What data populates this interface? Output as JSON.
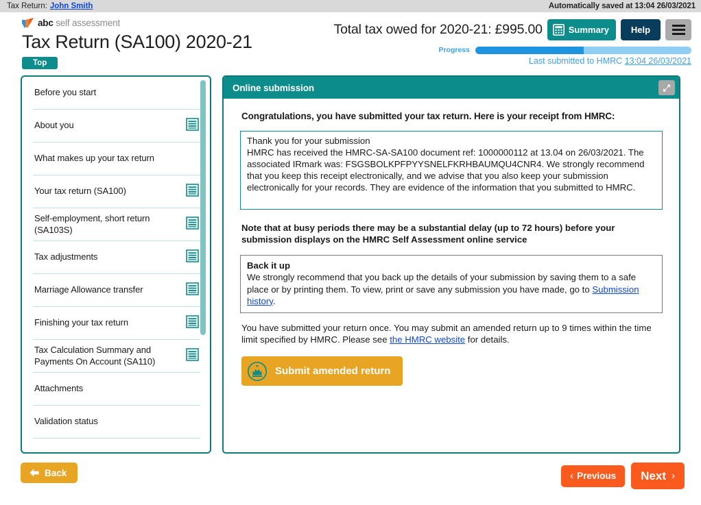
{
  "topbar": {
    "label": "Tax Return:",
    "user_name": "John Smith",
    "autosave": "Automatically saved at 13:04 26/03/2021"
  },
  "header": {
    "brand_abc": "abc",
    "brand_suffix": " self assessment",
    "page_title": "Tax Return (SA100) 2020-21",
    "top_badge": "Top",
    "total_owed": "Total tax owed for 2020-21: £995.00",
    "summary_label": "Summary",
    "help_label": "Help",
    "progress_label": "Progress",
    "progress_percent": 50,
    "last_submitted_label": "Last submitted to HMRC",
    "last_submitted_value": "13:04 26/03/2021"
  },
  "sidebar": {
    "items": [
      {
        "label": "Before you start",
        "has_doc_icon": false
      },
      {
        "label": "About you",
        "has_doc_icon": true
      },
      {
        "label": "What makes up your tax return",
        "has_doc_icon": false
      },
      {
        "label": "Your tax return (SA100)",
        "has_doc_icon": true
      },
      {
        "label": "Self-employment, short return (SA103S)",
        "has_doc_icon": true
      },
      {
        "label": "Tax adjustments",
        "has_doc_icon": true
      },
      {
        "label": "Marriage Allowance transfer",
        "has_doc_icon": true
      },
      {
        "label": "Finishing your tax return",
        "has_doc_icon": true
      },
      {
        "label": "Tax Calculation Summary and Payments On Account (SA110)",
        "has_doc_icon": true
      },
      {
        "label": "Attachments",
        "has_doc_icon": false
      },
      {
        "label": "Validation status",
        "has_doc_icon": false
      }
    ]
  },
  "panel": {
    "title": "Online submission",
    "congrats": "Congratulations, you have submitted your tax return. Here is your receipt from HMRC:",
    "receipt": {
      "line1": "Thank you for your submission",
      "line2": "HMRC has received the HMRC-SA-SA100 document ref: 1000000112 at 13.04 on 26/03/2021. The associated IRmark was: FSGSBOLKPFPYYSNELFKRHBAUMQU4CNR4. We strongly recommend that you keep this receipt electronically, and we advise that you also keep your submission electronically for your records. They are evidence of the information that you submitted to HMRC."
    },
    "note": "Note that at busy periods there may be a substantial delay (up to 72 hours) before your submission displays on the HMRC Self Assessment online service",
    "backup": {
      "title": "Back it up",
      "text_before": "We strongly recommend that you back up the details of your submission by saving them to a safe place or by printing them. To view, print or save any submission you have made, go to ",
      "link": "Submission history",
      "text_after": "."
    },
    "amend_note": {
      "text_before": "You have submitted your return once. You may submit an amended return up to 9 times within the time limit specified by HMRC. Please see ",
      "link": "the HMRC website",
      "text_after": " for details."
    },
    "amend_button": "Submit amended return"
  },
  "footer": {
    "back_label": "Back",
    "previous_label": "Previous",
    "next_label": "Next"
  },
  "colors": {
    "teal": "#0d8c8c",
    "teal_border": "#0d7a7a",
    "navy": "#0a3d5c",
    "amber": "#e8a524",
    "orange": "#fb5a1e",
    "link_blue": "#0d47d9",
    "progress_fill": "#1e94e0",
    "progress_track": "#8fcdf2"
  }
}
